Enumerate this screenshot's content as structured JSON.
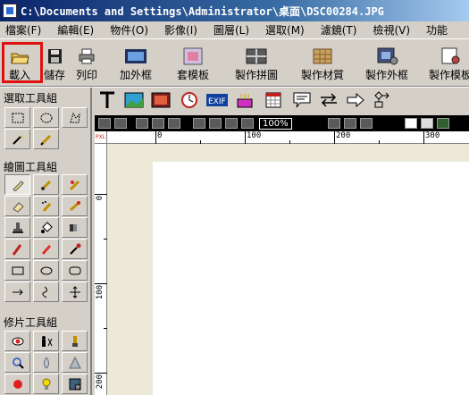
{
  "window": {
    "title": "C:\\Documents and Settings\\Administrator\\桌面\\DSC00284.JPG"
  },
  "menu": [
    "檔案(F)",
    "編輯(E)",
    "物件(O)",
    "影像(I)",
    "圖層(L)",
    "選取(M)",
    "濾鏡(T)",
    "檢視(V)",
    "功能"
  ],
  "toolbar": {
    "load": "載入",
    "save": "儲存",
    "print": "列印",
    "add_frame": "加外框",
    "template": "套模板",
    "make_collage": "製作拼圖",
    "make_material": "製作材質",
    "make_frame": "製作外框",
    "make_template": "製作模板",
    "highlight_color": "#e01010"
  },
  "sidebar": {
    "select_group": "選取工具組",
    "draw_group": "繪圖工具組",
    "retouch_group": "修片工具組"
  },
  "viewbar": {
    "zoom": "100%"
  },
  "ruler": {
    "corner": "PXL",
    "h_labels": [
      "0",
      "100",
      "200",
      "300"
    ],
    "v_labels": [
      "0",
      "100",
      "200"
    ]
  },
  "icons": {
    "load": "open-folder-icon",
    "save": "floppy-disk-icon",
    "print": "printer-icon"
  }
}
